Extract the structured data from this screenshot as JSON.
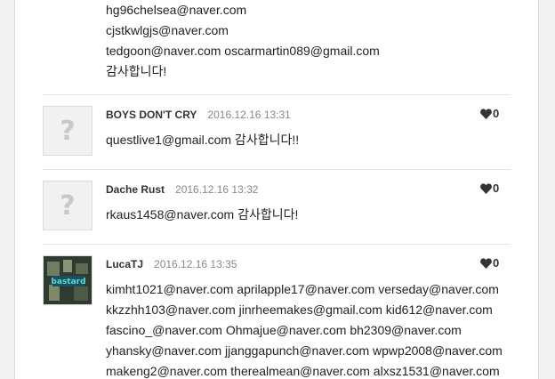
{
  "previous_comment": {
    "lines": [
      "hg96chelsea@naver.com",
      "cjstkwlgjs@naver.com",
      "tedgoon@naver.com oscarmartin089@gmail.com",
      "감사합니다!"
    ]
  },
  "comments": [
    {
      "author": "BOYS DON'T CRY",
      "date": "2016.12.16 13:31",
      "likes": "0",
      "avatar_icon": "question-mark-icon",
      "lines": [
        "questlive1@gmail.com 감사합니다!!"
      ]
    },
    {
      "author": "Dache Rust",
      "date": "2016.12.16 13:32",
      "likes": "0",
      "avatar_icon": "question-mark-icon",
      "lines": [
        "rkaus1458@naver.com 감사합니다!"
      ]
    },
    {
      "author": "LucaTJ",
      "date": "2016.12.16 13:35",
      "likes": "0",
      "avatar_text": "bastard",
      "lines": [
        "kimht1021@naver.com aprilapple17@naver.com verseday@naver.com",
        "kkzzhh103@naver.com jinrheemakes@gmail.com kid612@naver.com",
        "fascino_@naver.com Ohmajue@naver.com bh2309@naver.com",
        "yhansky@naver.com jjanggapunch@naver.com wpwp2008@naver.com",
        "makeng2@naver.com therealmean@naver.com alxsz1531@naver.com"
      ]
    }
  ],
  "colors": {
    "heart": "#333333",
    "divider": "#e6e6e6",
    "date": "#888888"
  }
}
